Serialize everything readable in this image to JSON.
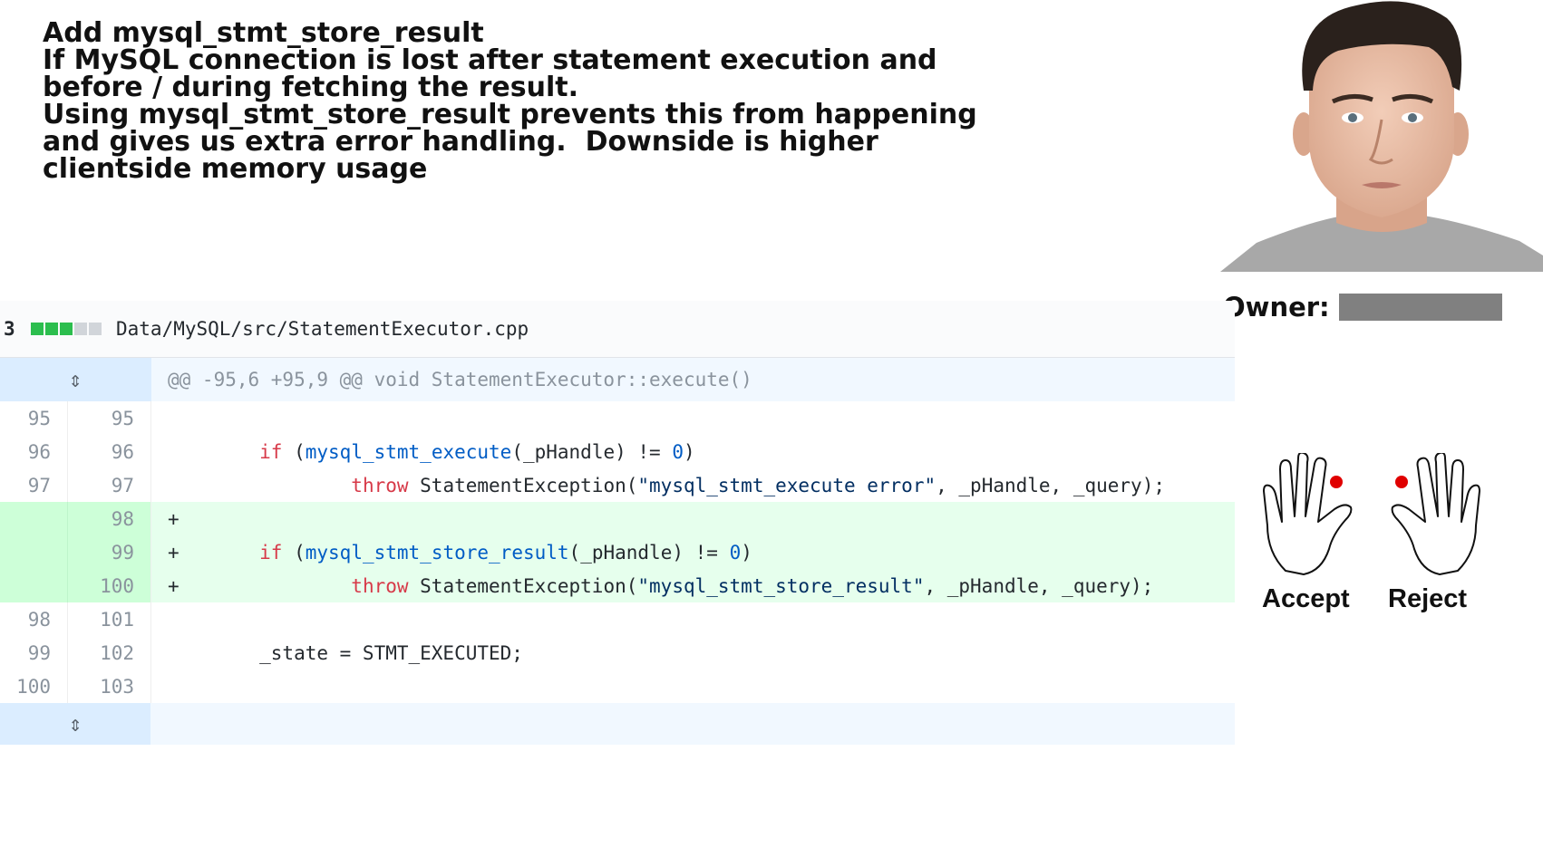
{
  "commit_message": {
    "lines": [
      "Add mysql_stmt_store_result",
      "If MySQL connection is lost after statement execution and",
      "before / during fetching the result.",
      "Using mysql_stmt_store_result prevents this from happening",
      "and gives us extra error handling.  Downside is higher",
      "clientside memory usage"
    ]
  },
  "owner": {
    "label": "Owner:"
  },
  "vote": {
    "accept_label": "Accept",
    "reject_label": "Reject"
  },
  "diff": {
    "changes_count": "3",
    "file_path": "Data/MySQL/src/StatementExecutor.cpp",
    "hunk_header": "@@ -95,6 +95,9 @@ void StatementExecutor::execute()",
    "rows": [
      {
        "old": "95",
        "new": "95",
        "type": "context",
        "code": ""
      },
      {
        "old": "96",
        "new": "96",
        "type": "context",
        "code": "        if (mysql_stmt_execute(_pHandle) != 0)"
      },
      {
        "old": "97",
        "new": "97",
        "type": "context",
        "code": "                throw StatementException(\"mysql_stmt_execute error\", _pHandle, _query);"
      },
      {
        "old": "",
        "new": "98",
        "type": "added",
        "code": "+"
      },
      {
        "old": "",
        "new": "99",
        "type": "added",
        "code": "+       if (mysql_stmt_store_result(_pHandle) != 0)"
      },
      {
        "old": "",
        "new": "100",
        "type": "added",
        "code": "+               throw StatementException(\"mysql_stmt_store_result\", _pHandle, _query);"
      },
      {
        "old": "98",
        "new": "101",
        "type": "context",
        "code": ""
      },
      {
        "old": "99",
        "new": "102",
        "type": "context",
        "code": "        _state = STMT_EXECUTED;"
      },
      {
        "old": "100",
        "new": "103",
        "type": "context",
        "code": ""
      }
    ]
  },
  "icons": {
    "expand": "unfold-icon",
    "portrait": "person-photo",
    "hand": "hand-outline-icon"
  },
  "colors": {
    "added_bg": "#e6ffed",
    "added_gutter": "#cdffd8",
    "hunk_bg": "#f1f8ff",
    "red_dot": "#e00000",
    "owner_bar": "#808080"
  }
}
